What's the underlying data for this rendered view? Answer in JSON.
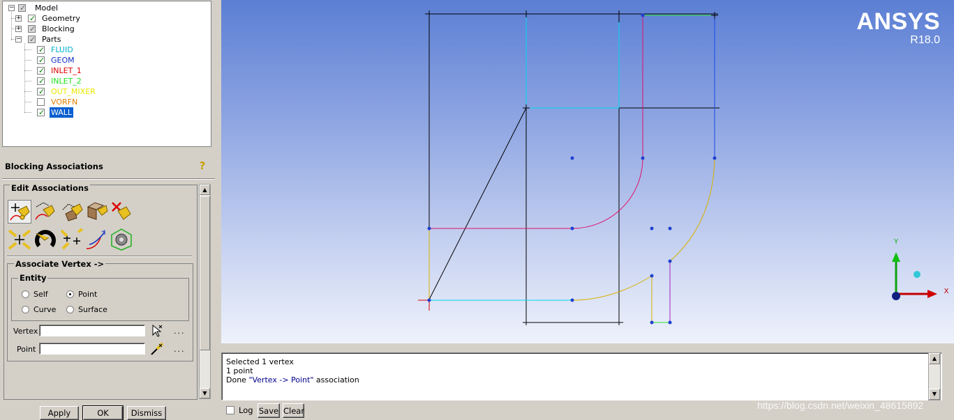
{
  "tree": {
    "root": "Model",
    "items": [
      {
        "label": "Geometry",
        "color": "#000000",
        "checked": true
      },
      {
        "label": "Blocking",
        "color": "#000000",
        "checked": true
      },
      {
        "label": "Parts",
        "color": "#000000",
        "checked": true
      }
    ],
    "parts": [
      {
        "label": "FLUID",
        "color": "#00b0d0",
        "checked": true
      },
      {
        "label": "GEOM",
        "color": "#1030c0",
        "checked": true
      },
      {
        "label": "INLET_1",
        "color": "#e00000",
        "checked": true
      },
      {
        "label": "INLET_2",
        "color": "#20e020",
        "checked": true
      },
      {
        "label": "OUT_MIXER",
        "color": "#e8e800",
        "checked": true
      },
      {
        "label": "VORFN",
        "color": "#e08000",
        "checked": false
      },
      {
        "label": "WALL",
        "color": "#ffffff",
        "checked": true,
        "selected": true
      }
    ]
  },
  "panel": {
    "title": "Blocking Associations",
    "edit_title": "Edit Associations",
    "associate_title": "Associate Vertex ->",
    "entity_title": "Entity",
    "entity_options": [
      "Self",
      "Point",
      "Curve",
      "Surface"
    ],
    "entity_selected": "Point",
    "vertex_label": "Vertex",
    "point_label": "Point",
    "vertex_value": "",
    "point_value": "",
    "more": "...",
    "buttons": {
      "apply": "Apply",
      "ok": "OK",
      "dismiss": "Dismiss"
    }
  },
  "brand": {
    "name": "ANSYS",
    "version": "R18.0"
  },
  "axes": {
    "x": "X",
    "y": "Y"
  },
  "messages": {
    "line1": "Selected 1 vertex",
    "line2": "1 point",
    "line3_pre": "Done ",
    "line3_q": "\"Vertex -> Point\"",
    "line3_post": " association"
  },
  "footer": {
    "log": "Log",
    "save": "Save",
    "clear": "Clear"
  },
  "watermark": "https://blog.csdn.net/weixin_48615892"
}
